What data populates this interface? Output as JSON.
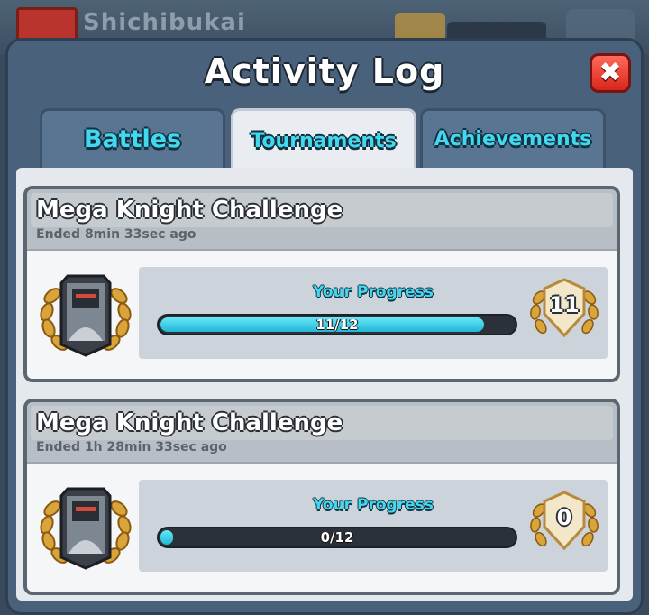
{
  "background": {
    "player_name": "Shichibukai"
  },
  "dialog": {
    "title": "Activity Log",
    "close_label": "✖"
  },
  "tabs": [
    {
      "label": "Battles",
      "active": false
    },
    {
      "label": "Tournaments",
      "active": true
    },
    {
      "label": "Achievements",
      "active": false
    }
  ],
  "tournaments": [
    {
      "name": "Mega Knight Challenge",
      "ended": "Ended 8min  33sec ago",
      "progress_label": "Your Progress",
      "progress_text": "11/12",
      "progress_fraction": 0.9167,
      "wins": "11"
    },
    {
      "name": "Mega Knight Challenge",
      "ended": "Ended 1h 28min  33sec ago",
      "progress_label": "Your Progress",
      "progress_text": "0/12",
      "progress_fraction": 0.0,
      "wins": "0"
    }
  ],
  "colors": {
    "accent_cyan": "#42d9ef",
    "close_red": "#e0342a",
    "gold": "#d9a43a"
  },
  "icons": {
    "card_badge": "mega-knight-card-icon",
    "rank_badge": "gold-laurel-badge-icon",
    "close": "close-icon"
  }
}
